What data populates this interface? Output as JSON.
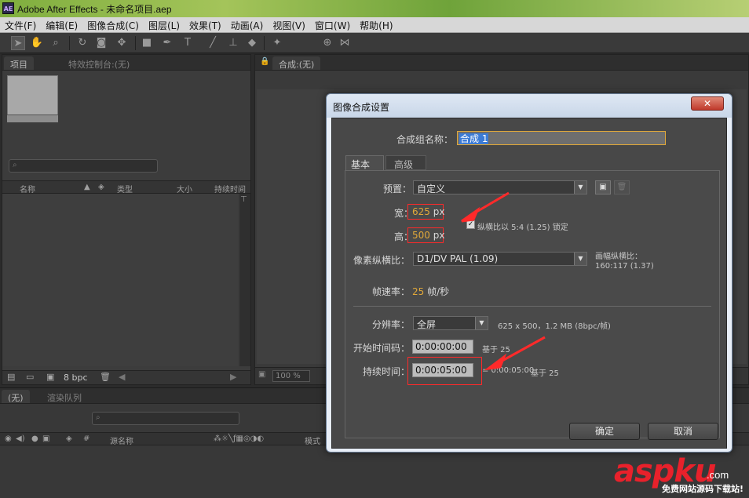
{
  "window": {
    "app_icon": "AE",
    "title": "Adobe After Effects - 未命名项目.aep"
  },
  "menu": [
    "文件(F)",
    "编辑(E)",
    "图像合成(C)",
    "图层(L)",
    "效果(T)",
    "动画(A)",
    "视图(V)",
    "窗口(W)",
    "帮助(H)"
  ],
  "toolbar": {
    "tools": [
      "select-arrow-icon",
      "hand-icon",
      "zoom-icon",
      "rotate-icon",
      "camera-icon",
      "pan-behind-icon",
      "rect-mask-icon",
      "pen-icon",
      "text-icon",
      "brush-icon",
      "stamp-icon",
      "eraser-icon",
      "puppet-icon",
      "axis-icon",
      "snap-icon"
    ]
  },
  "project_panel": {
    "tab_project": "项目",
    "tab_effects": "特效控制台:(无)",
    "columns": {
      "name": "名称",
      "type": "类型",
      "size": "大小",
      "duration": "持续时间"
    },
    "bpc": "8 bpc"
  },
  "comp_panel": {
    "tab_label": "合成:(无)",
    "zoom": "100 %"
  },
  "timeline_panel": {
    "tab_none": "(无)",
    "tab_render": "渲染队列",
    "col_num": "#",
    "col_layer": "源名称",
    "col_mode": "模式"
  },
  "dialog": {
    "title": "图像合成设置",
    "close": "✕",
    "comp_name_label": "合成组名称：",
    "comp_name_value": "合成 1",
    "tabs": {
      "basic": "基本",
      "advanced": "高级"
    },
    "preset_label": "预置：",
    "preset_value": "自定义",
    "width_label": "宽：",
    "width_value": "625",
    "width_unit": "px",
    "height_label": "高：",
    "height_value": "500",
    "height_unit": "px",
    "lock_aspect_text": "纵横比以 5:4 (1.25) 锁定",
    "pixel_aspect_label": "像素纵横比：",
    "pixel_aspect_value": "D1/DV PAL (1.09)",
    "frame_aspect_label": "画幅纵横比：",
    "frame_aspect_value": "160:117 (1.37)",
    "frame_rate_label": "帧速率：",
    "frame_rate_value": "25",
    "frame_rate_unit": "帧/秒",
    "resolution_label": "分辨率：",
    "resolution_value": "全屏",
    "resolution_info": "625 x 500，1.2 MB (8bpc/帧)",
    "start_tc_label": "开始时间码：",
    "start_tc_value": "0:00:00:00",
    "start_tc_base": "基于 25",
    "duration_label": "持续时间：",
    "duration_value": "0:00:05:00",
    "duration_note": "= 0:00:05:00",
    "duration_base": "基于 25",
    "ok": "确定",
    "cancel": "取消"
  },
  "watermark": {
    "brand": "aspku",
    "dotcom": ".com",
    "tagline": "免费网站源码下载站!"
  },
  "colors": {
    "ae_bg": "#3a3a3a",
    "dialog_body": "#484848",
    "value_orange": "#e0a83a",
    "annotation_red": "#ff2a2a"
  }
}
